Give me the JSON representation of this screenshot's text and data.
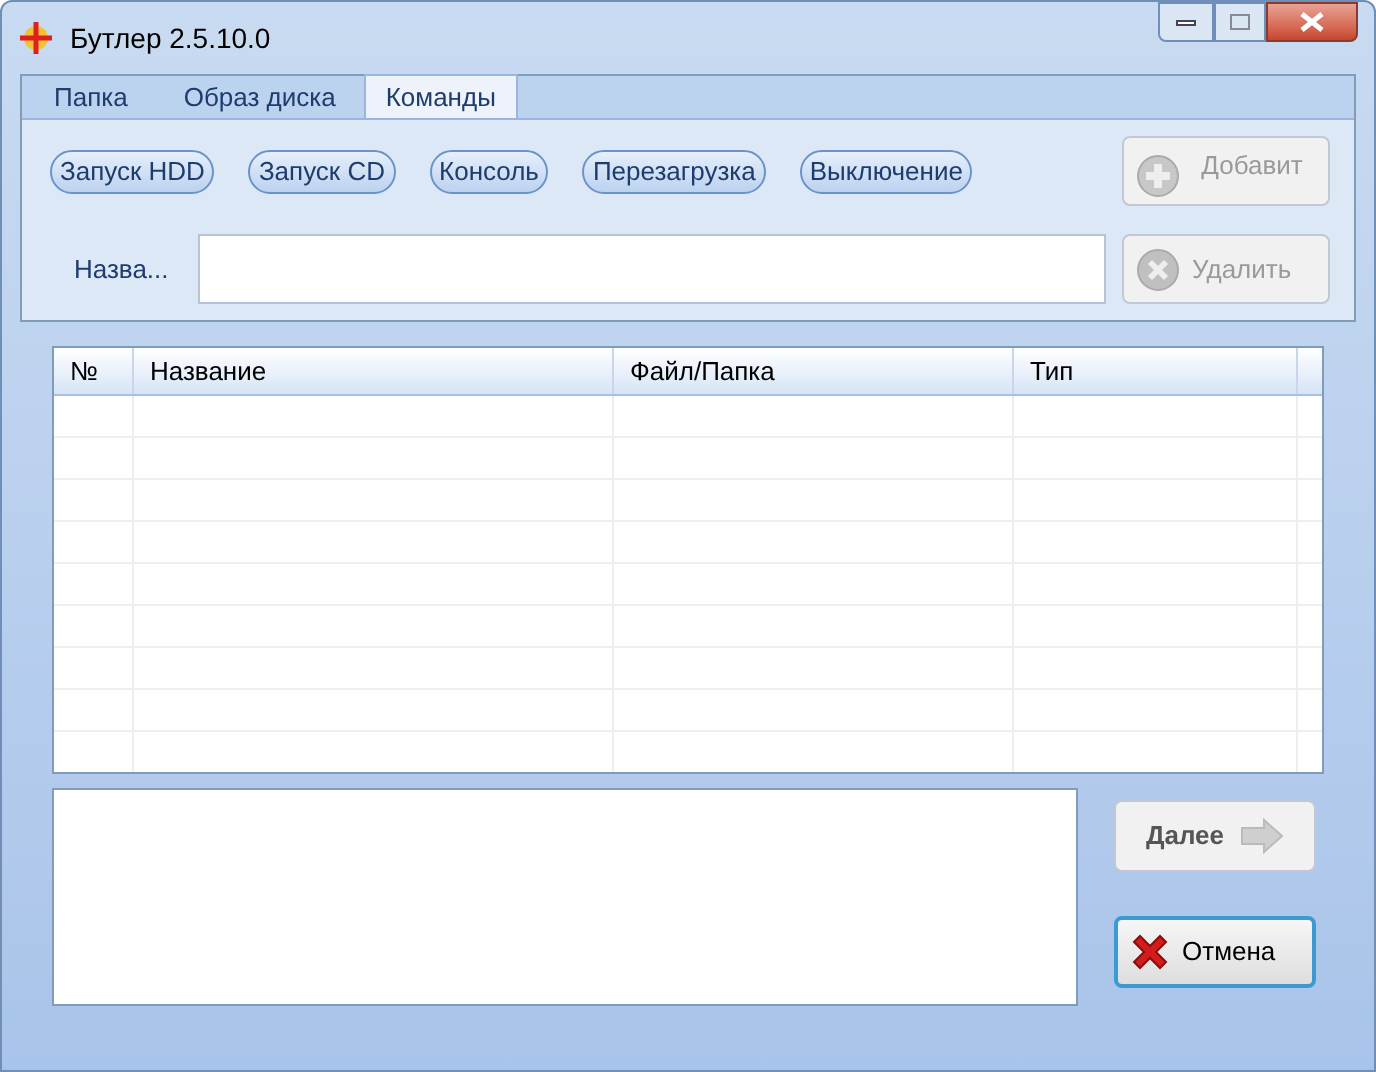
{
  "window": {
    "title": "Бутлер 2.5.10.0"
  },
  "tabs": [
    {
      "label": "Папка",
      "selected": false
    },
    {
      "label": "Образ диска",
      "selected": false
    },
    {
      "label": "Команды",
      "selected": true
    }
  ],
  "commands": [
    "Запуск HDD",
    "Запуск CD",
    "Консоль",
    "Перезагрузка",
    "Выключение"
  ],
  "add_button": {
    "label": "Добавит",
    "disabled": true
  },
  "name_field": {
    "label": "Назва..."
  },
  "delete_button": {
    "label": "Удалить",
    "disabled": true
  },
  "table": {
    "columns": [
      "№",
      "Название",
      "Файл/Папка",
      "Тип"
    ]
  },
  "next_button": {
    "label": "Далее",
    "disabled": true
  },
  "cancel_button": {
    "label": "Отмена",
    "disabled": false
  }
}
